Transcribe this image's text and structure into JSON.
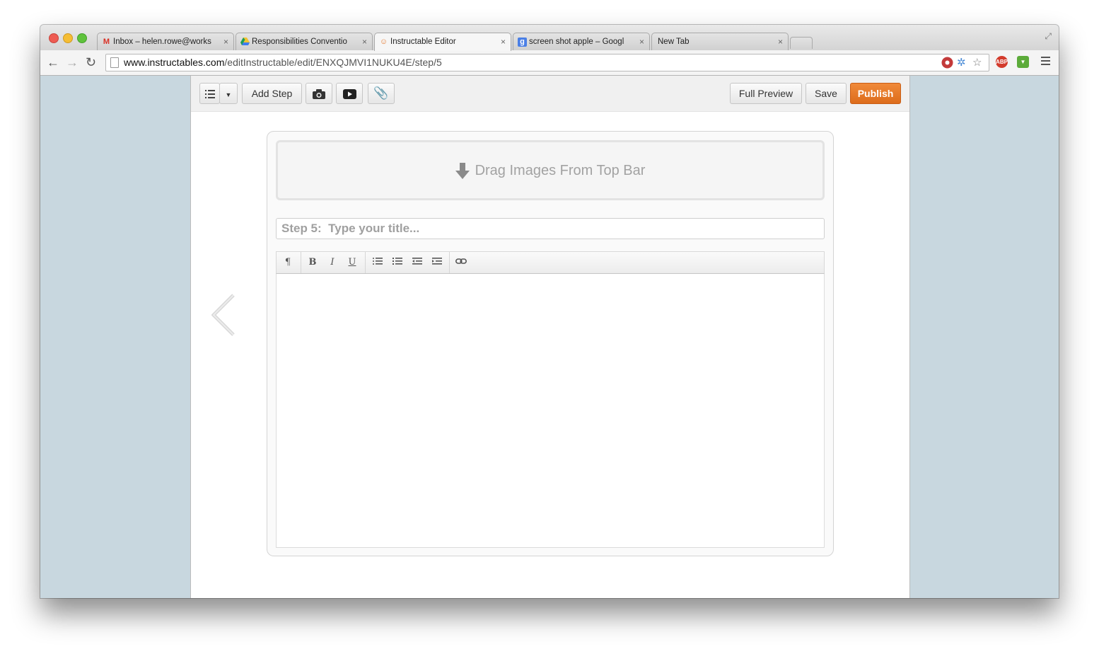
{
  "browser": {
    "tabs": [
      {
        "title": "Inbox – helen.rowe@works",
        "favicon": "gmail-icon",
        "close": "×"
      },
      {
        "title": "Responsibilities Conventio",
        "favicon": "google-drive-icon",
        "close": "×"
      },
      {
        "title": "Instructable Editor",
        "favicon": "instructables-icon",
        "close": "×",
        "active": true
      },
      {
        "title": "screen shot apple – Googl",
        "favicon": "google-search-icon",
        "close": "×"
      },
      {
        "title": "New Tab",
        "favicon": "",
        "close": "×"
      }
    ],
    "url_host": "www.instructables.com",
    "url_path": "/editInstructable/edit/ENXQJMVI1NUKU4E/step/5",
    "extensions": [
      "lastpass-icon",
      "network-icon",
      "bookmark-star-icon",
      "adblock-plus-icon",
      "extension-green-icon"
    ],
    "abp_label": "ABP"
  },
  "editor_toolbar": {
    "add_step": "Add Step",
    "full_preview": "Full Preview",
    "save": "Save",
    "publish": "Publish",
    "publish_color": "#e0701f"
  },
  "step": {
    "dropzone_text": "Drag Images From Top Bar",
    "title_placeholder": "Step 5:  Type your title...",
    "rte_buttons": [
      "¶",
      "B",
      "I",
      "U"
    ]
  }
}
